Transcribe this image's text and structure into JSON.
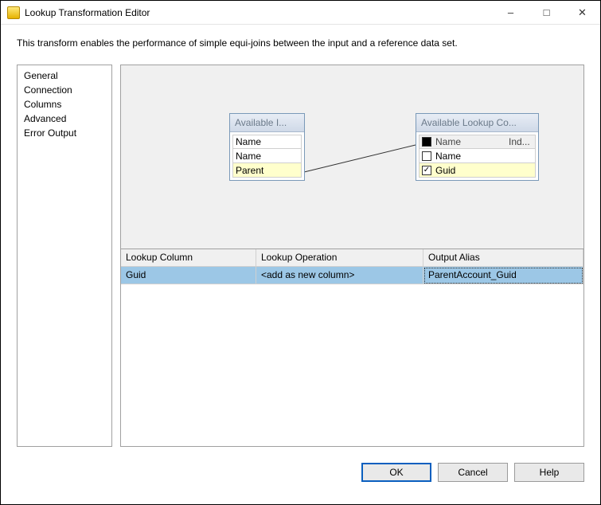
{
  "window": {
    "title": "Lookup Transformation Editor"
  },
  "description": "This transform enables the performance of simple equi-joins between the input and a reference data set.",
  "sidebar": {
    "items": [
      "General",
      "Connection",
      "Columns",
      "Advanced",
      "Error Output"
    ],
    "selected_index": 2
  },
  "mapping": {
    "input_box": {
      "title": "Available I...",
      "rows": [
        "Name",
        "Name",
        "Parent"
      ],
      "selected_index": 2
    },
    "lookup_box": {
      "title": "Available Lookup Co...",
      "header_cells": [
        "",
        "Name",
        "Ind..."
      ],
      "rows": [
        {
          "check": "filled",
          "label": "Name"
        },
        {
          "check": "empty",
          "label": "Name"
        },
        {
          "check": "checked",
          "label": "Guid"
        }
      ],
      "selected_index": 2
    }
  },
  "grid": {
    "headers": [
      "Lookup Column",
      "Lookup Operation",
      "Output Alias"
    ],
    "rows": [
      {
        "lookup_column": "Guid",
        "operation": "<add as new column>",
        "alias": "ParentAccount_Guid"
      }
    ]
  },
  "buttons": {
    "ok": "OK",
    "cancel": "Cancel",
    "help": "Help"
  }
}
